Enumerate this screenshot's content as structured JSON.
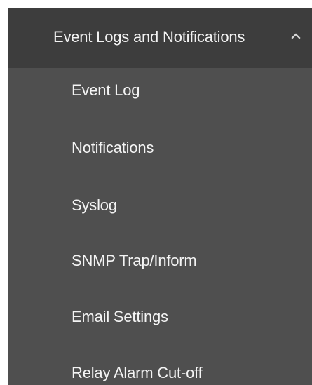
{
  "menu": {
    "header": {
      "label": "Event Logs and Notifications",
      "icon": "chevron-up-icon"
    },
    "items": [
      {
        "label": "Event Log"
      },
      {
        "label": "Notifications"
      },
      {
        "label": "Syslog"
      },
      {
        "label": "SNMP Trap/Inform"
      },
      {
        "label": "Email Settings"
      },
      {
        "label": "Relay Alarm Cut-off"
      }
    ],
    "colors": {
      "panel_bg": "#4f4f4f",
      "header_bg": "#3d3d3d",
      "text": "#f4f4f4"
    }
  }
}
